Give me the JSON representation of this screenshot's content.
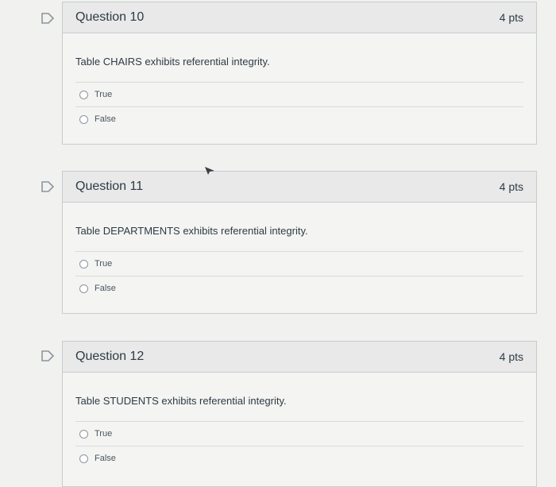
{
  "questions": [
    {
      "title": "Question 10",
      "points": "4 pts",
      "text": "Table CHAIRS exhibits referential integrity.",
      "answers": [
        "True",
        "False"
      ]
    },
    {
      "title": "Question 11",
      "points": "4 pts",
      "text": "Table DEPARTMENTS exhibits referential integrity.",
      "answers": [
        "True",
        "False"
      ]
    },
    {
      "title": "Question 12",
      "points": "4 pts",
      "text": "Table STUDENTS exhibits referential integrity.",
      "answers": [
        "True",
        "False"
      ]
    }
  ],
  "icons": {
    "flag": "flag-question-icon",
    "cursor": "mouse-cursor-icon"
  },
  "colors": {
    "flag": "#8b969e",
    "header_bg": "#e8e9e8",
    "border": "#c7cdd1"
  }
}
